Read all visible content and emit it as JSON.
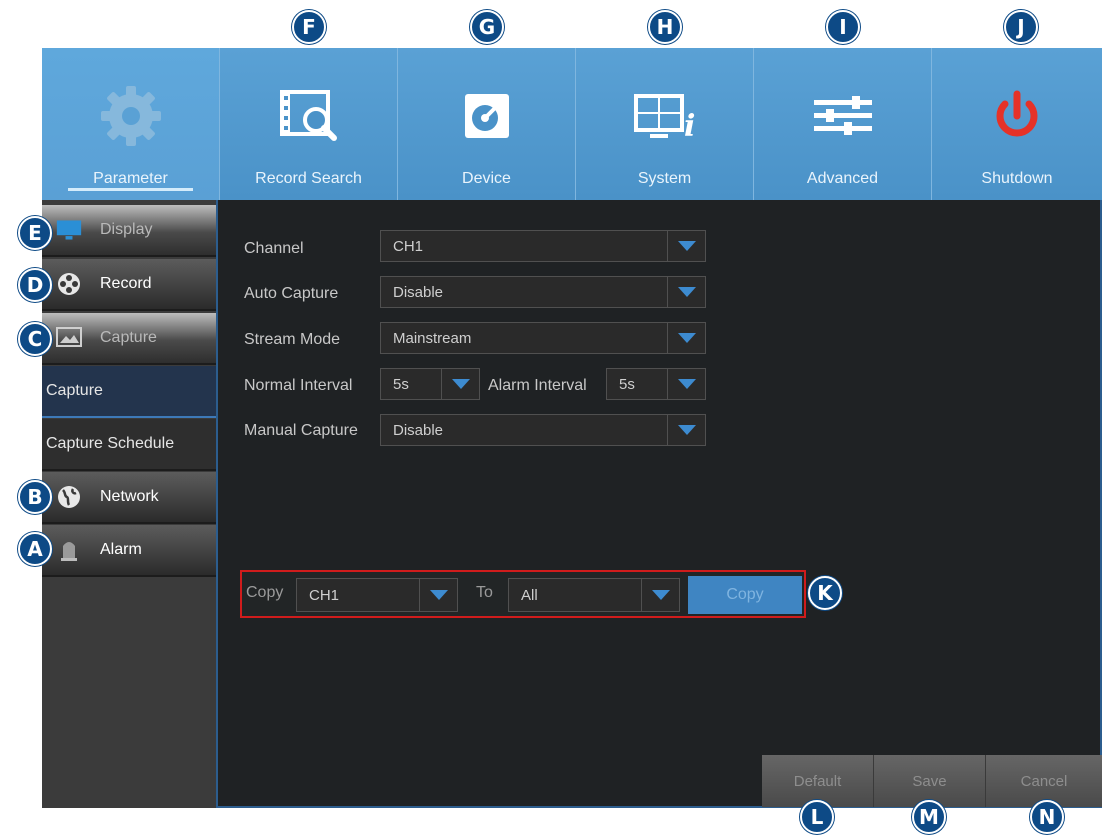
{
  "callouts": {
    "F": "F",
    "G": "G",
    "H": "H",
    "I": "I",
    "J": "J",
    "E": "E",
    "D": "D",
    "C": "C",
    "B": "B",
    "A": "A",
    "K": "K",
    "L": "L",
    "M": "M",
    "N": "N"
  },
  "nav": {
    "items": [
      {
        "label": "Parameter",
        "icon": "gear-icon"
      },
      {
        "label": "Record Search",
        "icon": "film-search-icon"
      },
      {
        "label": "Device",
        "icon": "hard-disk-icon"
      },
      {
        "label": "System",
        "icon": "monitor-info-icon"
      },
      {
        "label": "Advanced",
        "icon": "sliders-icon"
      },
      {
        "label": "Shutdown",
        "icon": "power-icon"
      }
    ]
  },
  "sidebar": {
    "items": [
      {
        "label": "Display",
        "icon": "monitor-icon"
      },
      {
        "label": "Record",
        "icon": "film-reel-icon"
      },
      {
        "label": "Capture",
        "icon": "picture-icon"
      },
      {
        "label": "Network",
        "icon": "globe-icon"
      },
      {
        "label": "Alarm",
        "icon": "alarm-siren-icon"
      }
    ],
    "sub_items": [
      "Capture",
      "Capture Schedule"
    ]
  },
  "form": {
    "channel_label": "Channel",
    "channel_value": "CH1",
    "auto_capture_label": "Auto Capture",
    "auto_capture_value": "Disable",
    "stream_mode_label": "Stream Mode",
    "stream_mode_value": "Mainstream",
    "normal_interval_label": "Normal Interval",
    "normal_interval_value": "5s",
    "alarm_interval_label": "Alarm Interval",
    "alarm_interval_value": "5s",
    "manual_capture_label": "Manual Capture",
    "manual_capture_value": "Disable"
  },
  "copy": {
    "copy_label": "Copy",
    "from_value": "CH1",
    "to_label": "To",
    "to_value": "All",
    "button_label": "Copy"
  },
  "actions": {
    "default_label": "Default",
    "save_label": "Save",
    "cancel_label": "Cancel"
  },
  "colors": {
    "nav_bar": "#4a92c8",
    "accent": "#3d8bd0",
    "copy_highlight": "#d01c1c",
    "power_icon": "#e53228",
    "callout": "#0d4a86"
  }
}
